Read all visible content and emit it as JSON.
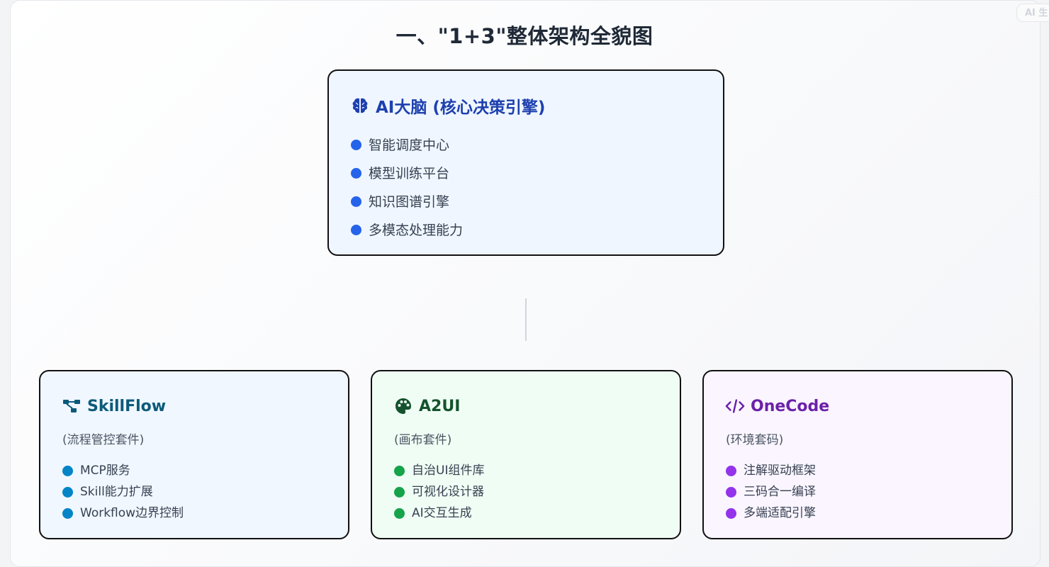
{
  "badge": "AI 生",
  "title": "一、\"1+3\"整体架构全貌图",
  "core": {
    "title": "AI大脑 (核心决策引擎)",
    "icon": "brain-icon",
    "dot_color": "#2563eb",
    "items": [
      "智能调度中心",
      "模型训练平台",
      "知识图谱引擎",
      "多模态处理能力"
    ]
  },
  "modules": [
    {
      "title": "SkillFlow",
      "icon": "flow-diagram-icon",
      "subtitle": "(流程管控套件)",
      "dot_color": "#0284c7",
      "items": [
        "MCP服务",
        "Skill能力扩展",
        "Workflow边界控制"
      ]
    },
    {
      "title": "A2UI",
      "icon": "palette-icon",
      "subtitle": "(画布套件)",
      "dot_color": "#16a34a",
      "items": [
        "自治UI组件库",
        "可视化设计器",
        "AI交互生成"
      ]
    },
    {
      "title": "OneCode",
      "icon": "code-icon",
      "subtitle": "(环境套码)",
      "dot_color": "#9333ea",
      "items": [
        "注解驱动框架",
        "三码合一编译",
        "多端适配引擎"
      ]
    }
  ]
}
